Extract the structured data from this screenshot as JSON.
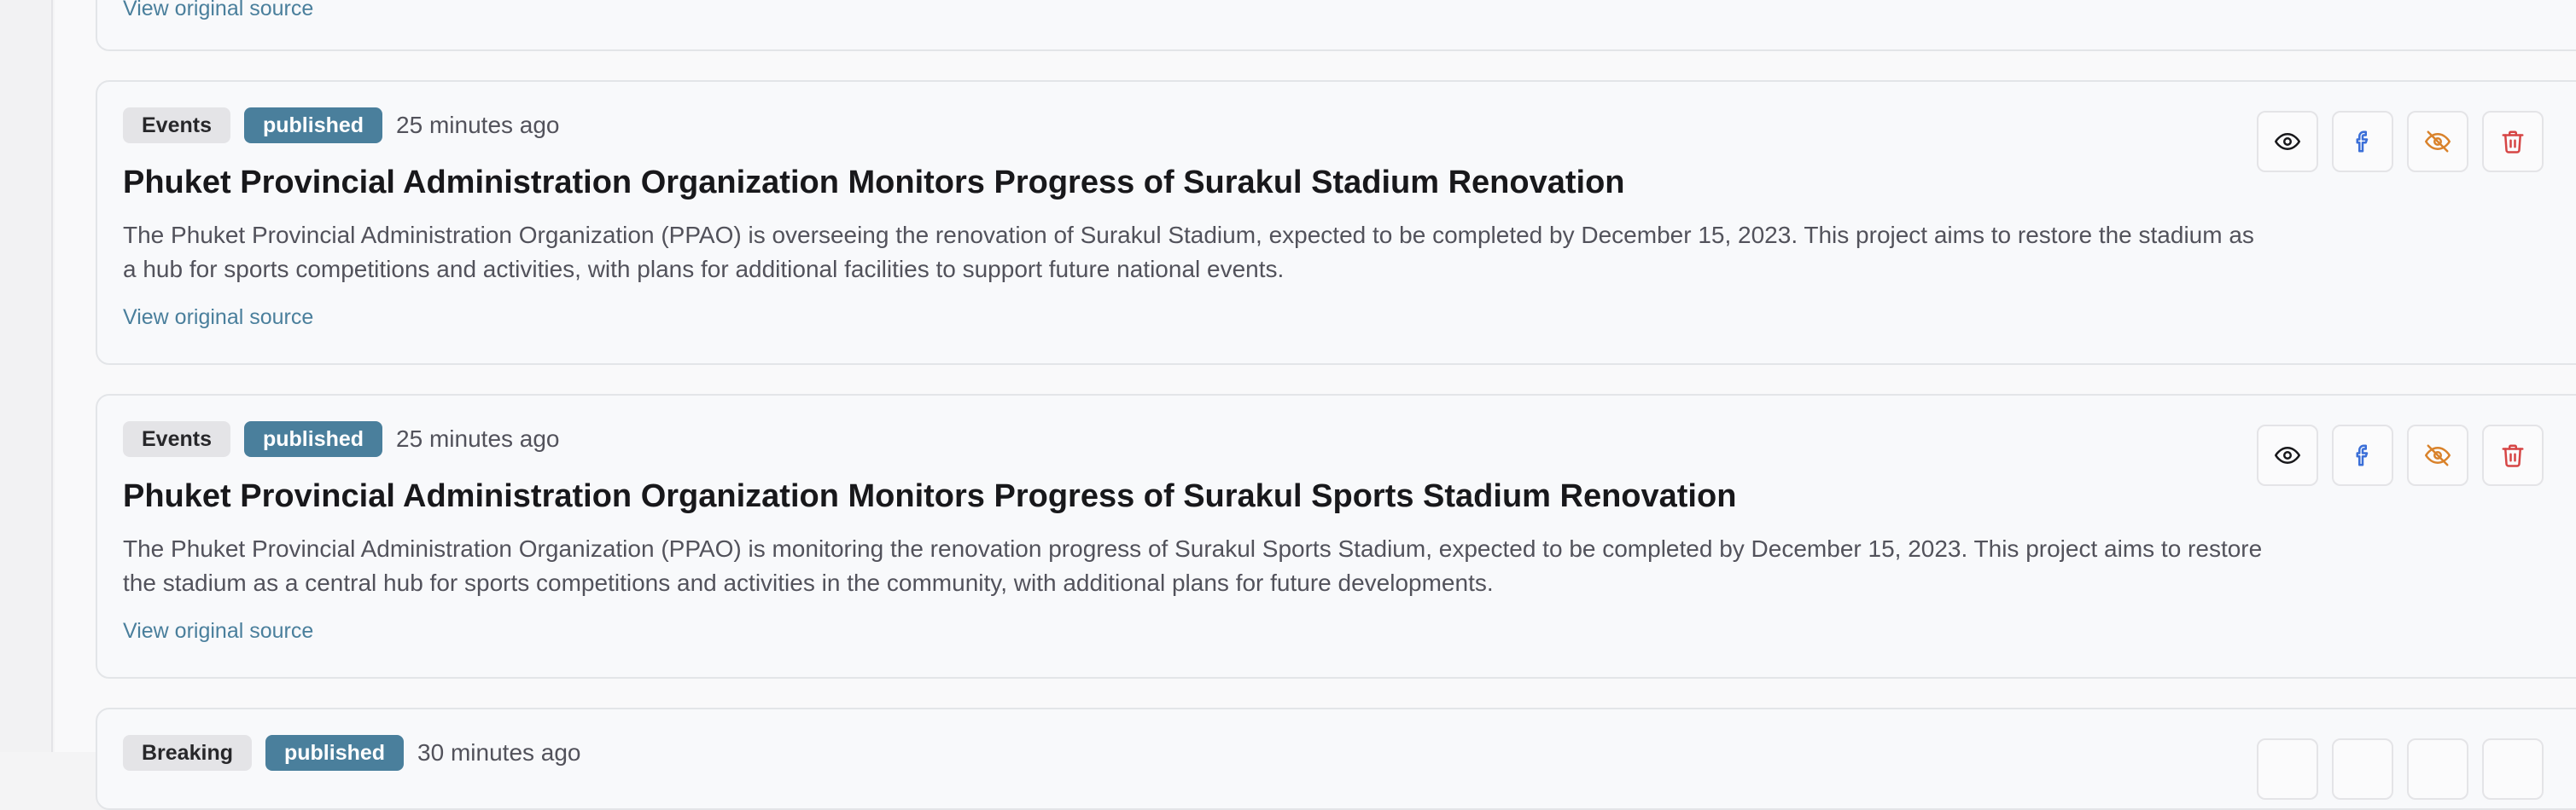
{
  "top_link": "View original source",
  "cards": [
    {
      "category": "Events",
      "status": "published",
      "time": "25 minutes ago",
      "title": "Phuket Provincial Administration Organization Monitors Progress of Surakul Stadium Renovation",
      "description": "The Phuket Provincial Administration Organization (PPAO) is overseeing the renovation of Surakul Stadium, expected to be completed by December 15, 2023. This project aims to restore the stadium as a hub for sports competitions and activities, with plans for additional facilities to support future national events.",
      "link": "View original source"
    },
    {
      "category": "Events",
      "status": "published",
      "time": "25 minutes ago",
      "title": "Phuket Provincial Administration Organization Monitors Progress of Surakul Sports Stadium Renovation",
      "description": "The Phuket Provincial Administration Organization (PPAO) is monitoring the renovation progress of Surakul Sports Stadium, expected to be completed by December 15, 2023. This project aims to restore the stadium as a central hub for sports competitions and activities in the community, with additional plans for future developments.",
      "link": "View original source"
    },
    {
      "category": "Breaking",
      "status": "published",
      "time": "30 minutes ago"
    }
  ],
  "icons": {
    "view": "eye-icon",
    "share": "facebook-icon",
    "hide": "eye-off-icon",
    "delete": "trash-icon"
  },
  "colors": {
    "status_badge": "#4a7f9c",
    "link": "#4a7f9c",
    "facebook": "#3b6fd8",
    "hide": "#d9822b",
    "delete": "#d64545"
  }
}
